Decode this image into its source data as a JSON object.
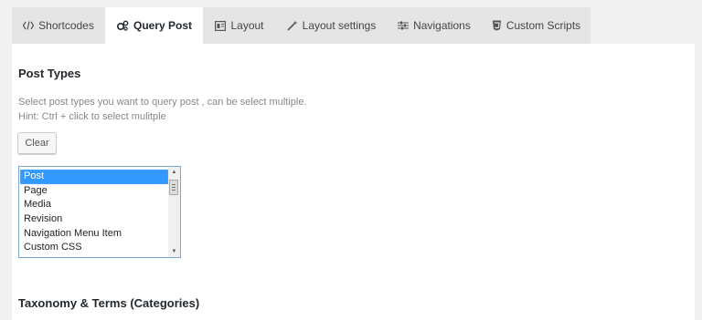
{
  "tabs": [
    {
      "label": "Shortcodes",
      "icon": "code-icon",
      "active": false
    },
    {
      "label": "Query Post",
      "icon": "gears-icon",
      "active": true
    },
    {
      "label": "Layout",
      "icon": "layout-icon",
      "active": false
    },
    {
      "label": "Layout settings",
      "icon": "magic-wand-icon",
      "active": false
    },
    {
      "label": "Navigations",
      "icon": "sliders-icon",
      "active": false
    },
    {
      "label": "Custom Scripts",
      "icon": "css3-icon",
      "active": false
    }
  ],
  "post_types": {
    "heading": "Post Types",
    "description": "Select post types you want to query post , can be select multiple.",
    "hint": "Hint: Ctrl + click to select mulitple",
    "clear_label": "Clear",
    "options": [
      "Post",
      "Page",
      "Media",
      "Revision",
      "Navigation Menu Item",
      "Custom CSS"
    ],
    "selected": "Post"
  },
  "taxonomy": {
    "heading": "Taxonomy & Terms (Categories)"
  },
  "colors": {
    "selection": "#3399ff",
    "listbox_border": "#7aa7d6",
    "tab_bar": "#e5e5e5"
  }
}
